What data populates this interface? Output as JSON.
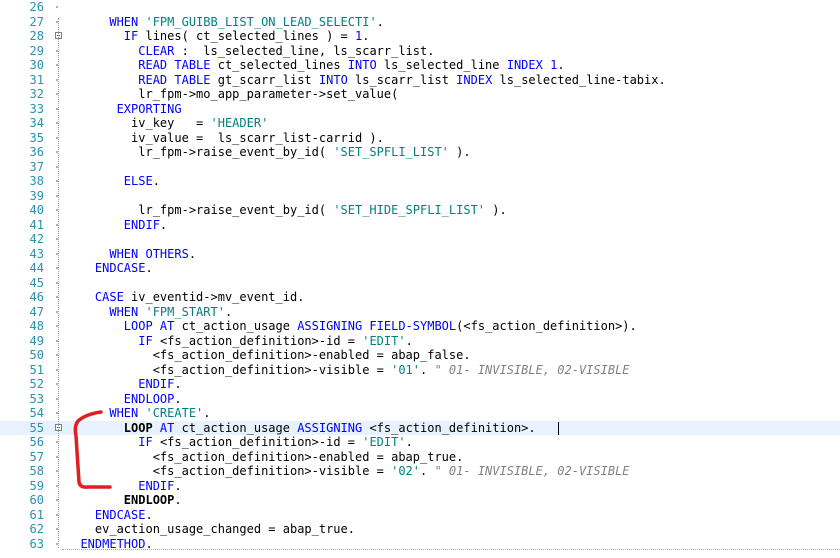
{
  "editor": {
    "lines": [
      {
        "n": "26",
        "t": []
      },
      {
        "n": "27",
        "t": [
          [
            "",
            "      "
          ],
          [
            "kw",
            "WHEN "
          ],
          [
            "str",
            "'FPM_GUIBB_LIST_ON_LEAD_SELECTI'"
          ],
          [
            "",
            "."
          ]
        ]
      },
      {
        "n": "28",
        "t": [
          [
            "",
            "        "
          ],
          [
            "kw",
            "IF "
          ],
          [
            "",
            "lines( ct_selected_lines ) = "
          ],
          [
            "num",
            "1"
          ],
          [
            "",
            "."
          ]
        ]
      },
      {
        "n": "29",
        "t": [
          [
            "",
            "          "
          ],
          [
            "kw",
            "CLEAR "
          ],
          [
            "",
            ":  ls_selected_line, ls_scarr_list."
          ]
        ]
      },
      {
        "n": "30",
        "t": [
          [
            "",
            "          "
          ],
          [
            "kw",
            "READ TABLE "
          ],
          [
            "",
            "ct_selected_lines "
          ],
          [
            "kw",
            "INTO "
          ],
          [
            "",
            "ls_selected_line "
          ],
          [
            "kw",
            "INDEX "
          ],
          [
            "num",
            "1"
          ],
          [
            "",
            "."
          ]
        ]
      },
      {
        "n": "31",
        "t": [
          [
            "",
            "          "
          ],
          [
            "kw",
            "READ TABLE "
          ],
          [
            "",
            "gt_scarr_list "
          ],
          [
            "kw",
            "INTO "
          ],
          [
            "",
            "ls_scarr_list "
          ],
          [
            "kw",
            "INDEX "
          ],
          [
            "",
            "ls_selected_line-tabix."
          ]
        ]
      },
      {
        "n": "32",
        "t": [
          [
            "",
            "          lr_fpm->mo_app_parameter->set_value("
          ]
        ]
      },
      {
        "n": "33",
        "t": [
          [
            "",
            "       "
          ],
          [
            "kw",
            "EXPORTING"
          ]
        ]
      },
      {
        "n": "34",
        "t": [
          [
            "",
            "         iv_key   = "
          ],
          [
            "str",
            "'HEADER'"
          ]
        ]
      },
      {
        "n": "35",
        "t": [
          [
            "",
            "         iv_value =  ls_scarr_list-carrid )."
          ]
        ]
      },
      {
        "n": "36",
        "t": [
          [
            "",
            "          lr_fpm->raise_event_by_id( "
          ],
          [
            "str",
            "'SET_SPFLI_LIST'"
          ],
          [
            "",
            " )."
          ]
        ]
      },
      {
        "n": "37",
        "t": []
      },
      {
        "n": "38",
        "t": [
          [
            "",
            "        "
          ],
          [
            "kw",
            "ELSE"
          ],
          [
            "",
            "."
          ]
        ]
      },
      {
        "n": "39",
        "t": []
      },
      {
        "n": "40",
        "t": [
          [
            "",
            "          lr_fpm->raise_event_by_id( "
          ],
          [
            "str",
            "'SET_HIDE_SPFLI_LIST'"
          ],
          [
            "",
            " )."
          ]
        ]
      },
      {
        "n": "41",
        "t": [
          [
            "",
            "        "
          ],
          [
            "kw",
            "ENDIF"
          ],
          [
            "",
            "."
          ]
        ]
      },
      {
        "n": "42",
        "t": []
      },
      {
        "n": "43",
        "t": [
          [
            "",
            "      "
          ],
          [
            "kw",
            "WHEN OTHERS"
          ],
          [
            "",
            "."
          ]
        ]
      },
      {
        "n": "44",
        "t": [
          [
            "",
            "    "
          ],
          [
            "kw",
            "ENDCASE"
          ],
          [
            "",
            "."
          ]
        ]
      },
      {
        "n": "45",
        "t": []
      },
      {
        "n": "46",
        "t": [
          [
            "",
            "    "
          ],
          [
            "kw",
            "CASE "
          ],
          [
            "",
            "iv_eventid->mv_event_id."
          ]
        ]
      },
      {
        "n": "47",
        "t": [
          [
            "",
            "      "
          ],
          [
            "kw",
            "WHEN "
          ],
          [
            "str",
            "'FPM_START'"
          ],
          [
            "",
            "."
          ]
        ]
      },
      {
        "n": "48",
        "t": [
          [
            "",
            "        "
          ],
          [
            "kw",
            "LOOP AT "
          ],
          [
            "",
            "ct_action_usage "
          ],
          [
            "kw",
            "ASSIGNING FIELD-SYMBOL"
          ],
          [
            "",
            "(<fs_action_definition>)."
          ]
        ]
      },
      {
        "n": "49",
        "t": [
          [
            "",
            "          "
          ],
          [
            "kw",
            "IF "
          ],
          [
            "",
            "<fs_action_definition>-id = "
          ],
          [
            "str",
            "'EDIT'"
          ],
          [
            "",
            "."
          ]
        ]
      },
      {
        "n": "50",
        "t": [
          [
            "",
            "            <fs_action_definition>-enabled = abap_false."
          ]
        ]
      },
      {
        "n": "51",
        "t": [
          [
            "",
            "            <fs_action_definition>-visible = "
          ],
          [
            "str",
            "'01'"
          ],
          [
            "",
            ". "
          ],
          [
            "cmt",
            "\" 01- INVISIBLE, 02-VISIBLE"
          ]
        ]
      },
      {
        "n": "52",
        "t": [
          [
            "",
            "          "
          ],
          [
            "kw",
            "ENDIF"
          ],
          [
            "",
            "."
          ]
        ]
      },
      {
        "n": "53",
        "t": [
          [
            "",
            "        "
          ],
          [
            "kw",
            "ENDLOOP"
          ],
          [
            "",
            "."
          ]
        ]
      },
      {
        "n": "54",
        "t": [
          [
            "",
            "      "
          ],
          [
            "kw",
            "WHEN "
          ],
          [
            "str",
            "'CREATE'"
          ],
          [
            "",
            "."
          ]
        ]
      },
      {
        "n": "55",
        "t": [
          [
            "",
            "        "
          ],
          [
            "bk",
            "LOOP "
          ],
          [
            "kw",
            "AT "
          ],
          [
            "",
            "ct_action_usage "
          ],
          [
            "kw",
            "ASSIGNING "
          ],
          [
            "",
            "<fs_action_definition>."
          ]
        ]
      },
      {
        "n": "56",
        "t": [
          [
            "",
            "          "
          ],
          [
            "kw",
            "IF "
          ],
          [
            "",
            "<fs_action_definition>-id = "
          ],
          [
            "str",
            "'EDIT'"
          ],
          [
            "",
            "."
          ]
        ]
      },
      {
        "n": "57",
        "t": [
          [
            "",
            "            <fs_action_definition>-enabled = abap_true."
          ]
        ]
      },
      {
        "n": "58",
        "t": [
          [
            "",
            "            <fs_action_definition>-visible = "
          ],
          [
            "str",
            "'02'"
          ],
          [
            "",
            ". "
          ],
          [
            "cmt",
            "\" 01- INVISIBLE, 02-VISIBLE"
          ]
        ]
      },
      {
        "n": "59",
        "t": [
          [
            "",
            "          "
          ],
          [
            "kw",
            "ENDIF"
          ],
          [
            "",
            "."
          ]
        ]
      },
      {
        "n": "60",
        "t": [
          [
            "",
            "        "
          ],
          [
            "bk",
            "ENDLOOP"
          ],
          [
            "",
            "."
          ]
        ]
      },
      {
        "n": "61",
        "t": [
          [
            "",
            "    "
          ],
          [
            "kw",
            "ENDCASE"
          ],
          [
            "",
            "."
          ]
        ]
      },
      {
        "n": "62",
        "t": [
          [
            "",
            "    ev_action_usage_changed = abap_true."
          ]
        ]
      },
      {
        "n": "63",
        "t": [
          [
            "",
            "  "
          ],
          [
            "kw",
            "ENDMETHOD"
          ],
          [
            "",
            "."
          ]
        ]
      }
    ],
    "current_line": "55",
    "fold_markers": [
      "28",
      "55"
    ],
    "colors": {
      "keyword": "#0000ff",
      "string": "#008080",
      "comment": "#808080",
      "line_number": "#2b91af",
      "current_line_bg": "#e8f2fe",
      "annotation": "#e02020"
    }
  }
}
